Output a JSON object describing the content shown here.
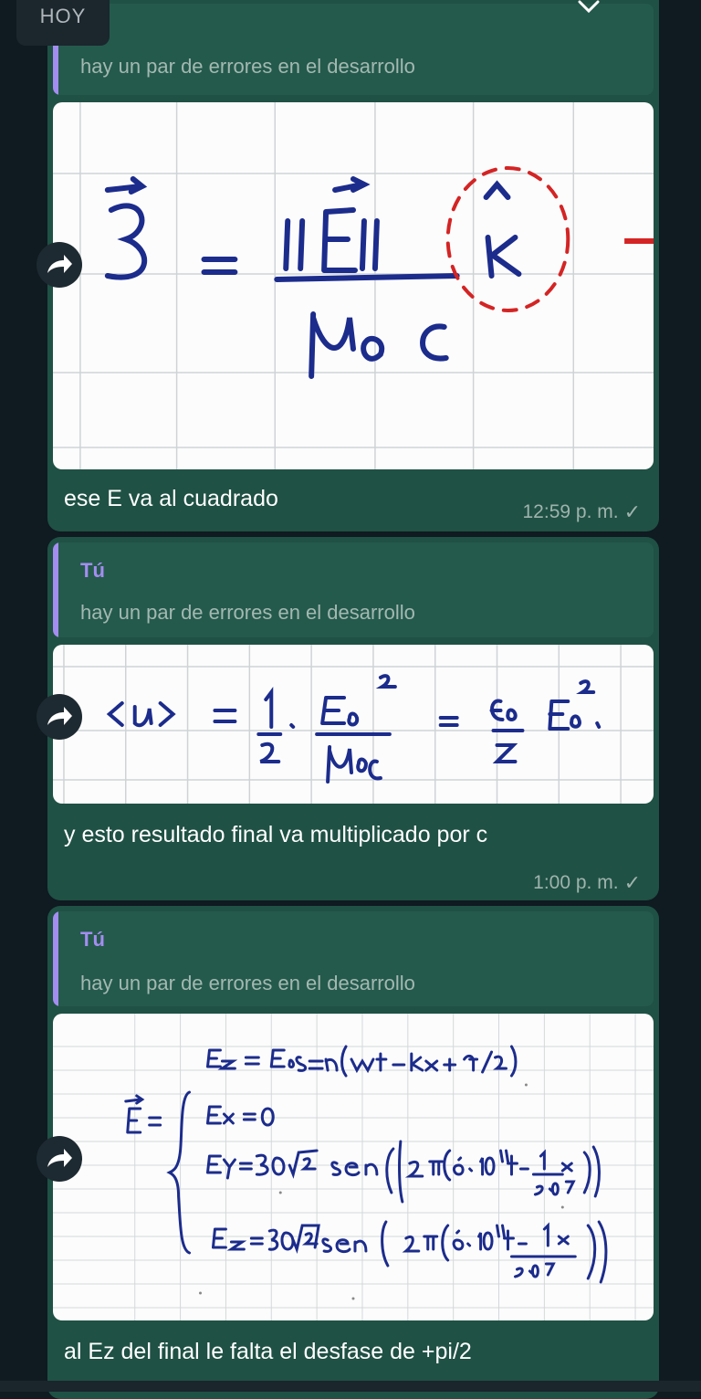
{
  "date_chip": "HOY",
  "messages": [
    {
      "quote_author": "",
      "quote_text": "hay un par de errores en el desarrollo",
      "photo_icon": "handwritten-poynting-vector",
      "text": "ese E va al cuadrado",
      "time": "12:59 p. m."
    },
    {
      "quote_author": "Tú",
      "quote_text": "hay un par de errores en el desarrollo",
      "photo_icon": "handwritten-energy-density",
      "text": "y esto resultado final va multiplicado por c",
      "time": "1:00 p. m."
    },
    {
      "quote_author": "Tú",
      "quote_text": "hay un par de errores en el desarrollo",
      "photo_icon": "handwritten-electric-field",
      "text": "al Ez del final le falta el desfase de +pi/2",
      "time": ""
    }
  ],
  "colors": {
    "bubble": "#1f5144",
    "quote_bar": "#a48df0",
    "ink": "#1c2c8c",
    "red_ink": "#d42424"
  }
}
